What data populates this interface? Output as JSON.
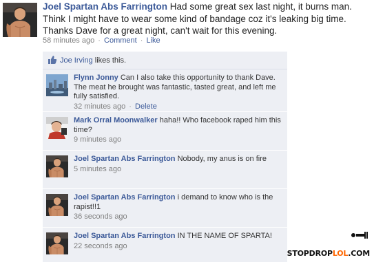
{
  "post": {
    "author": "Joel Spartan Abs Farrington",
    "text": "Had some great sex last night, it burns man. Think I might have to wear some kind of bandage coz it's leaking big time. Thanks Dave for a great night, can't wait for this evening.",
    "time": "58 minutes ago",
    "separator": "·",
    "comment_label": "Comment",
    "like_label": "Like",
    "avatar_icon": "user-photo-icon"
  },
  "likes": {
    "name": "Joe Irving",
    "suffix": "likes this.",
    "icon": "thumbs-up-icon"
  },
  "comments": [
    {
      "author": "Flynn Jonny",
      "text": "Can I also take this opportunity to thank Dave. The meat he brought was fantastic, tasted great, and left me fully satisfied.",
      "time": "32 minutes ago",
      "delete_label": "Delete"
    },
    {
      "author": "Mark Orral Moonwalker",
      "text": "haha!! Who facebook raped him this time?",
      "time": "9 minutes ago"
    },
    {
      "author": "Joel Spartan Abs Farrington",
      "text": "Nobody, my anus is on fire",
      "time": "5 minutes ago"
    },
    {
      "author": "Joel Spartan Abs Farrington",
      "text": "i demand to know who is the rapist!!1",
      "time": "36 seconds ago"
    },
    {
      "author": "Joel Spartan Abs Farrington",
      "text": "IN THE NAME OF SPARTA!",
      "time": "22 seconds ago"
    }
  ],
  "watermark": {
    "part1": "STOPDROP",
    "part2": "LOL",
    "part3": ".COM"
  },
  "colors": {
    "link": "#3b5998",
    "feedback_bg": "#edeff4",
    "meta": "#808080",
    "watermark_accent": "#ff6600"
  }
}
